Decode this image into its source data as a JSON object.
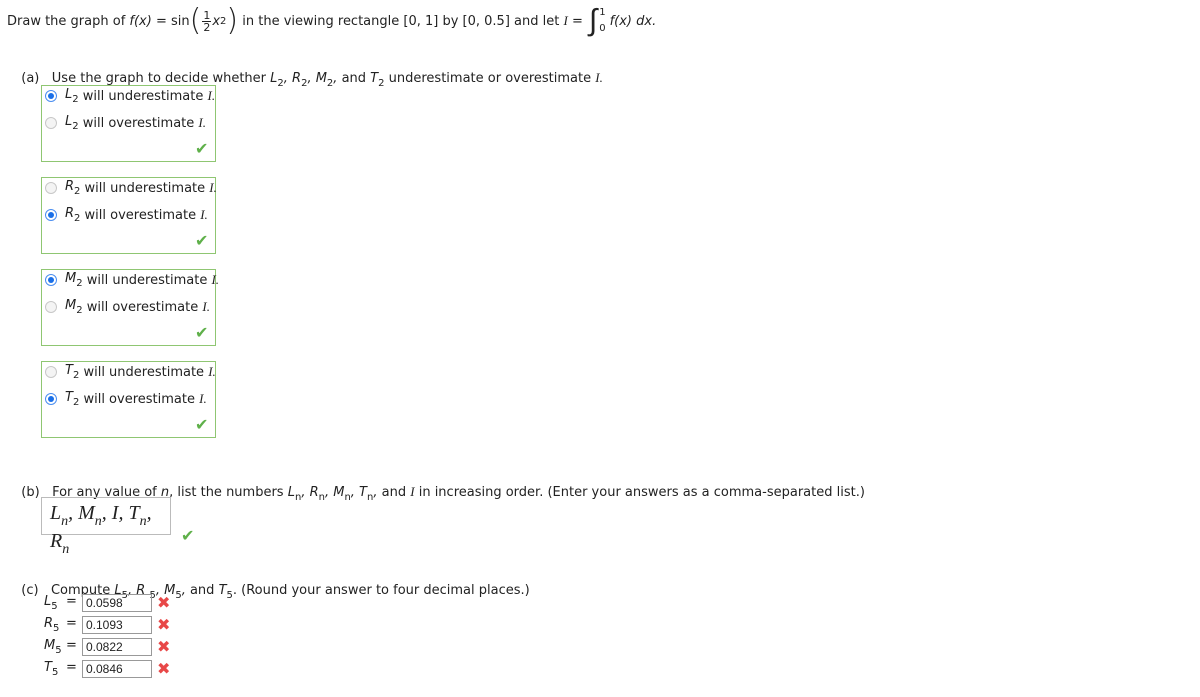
{
  "header": {
    "prefix": "Draw the graph of ",
    "fx": "f(x)",
    "eq_sin": " = sin",
    "frac_num": "1",
    "frac_den": "2",
    "x2": "x",
    "sup2": "2",
    "middle": " in the viewing rectangle [0, 1] by [0, 0.5] and let ",
    "I": "I",
    "eq": " = ",
    "int_upper": "1",
    "int_lower": "0",
    "integrand": "f(x) dx."
  },
  "part_a": {
    "label": "(a)",
    "text_prefix": "Use the graph to decide whether ",
    "text_suffix": " underestimate or overestimate ",
    "I": "I.",
    "groups": [
      {
        "sym": "L",
        "sub": "2",
        "options": [
          {
            "text": " will underestimate ",
            "selected": true
          },
          {
            "text": " will overestimate ",
            "selected": false
          }
        ]
      },
      {
        "sym": "R",
        "sub": "2",
        "options": [
          {
            "text": " will underestimate ",
            "selected": false
          },
          {
            "text": " will overestimate ",
            "selected": true
          }
        ]
      },
      {
        "sym": "M",
        "sub": "2",
        "options": [
          {
            "text": " will underestimate ",
            "selected": true
          },
          {
            "text": " will overestimate ",
            "selected": false
          }
        ]
      },
      {
        "sym": "T",
        "sub": "2",
        "options": [
          {
            "text": " will underestimate ",
            "selected": false
          },
          {
            "text": " will overestimate ",
            "selected": true
          }
        ]
      }
    ],
    "I_text": "I."
  },
  "part_b": {
    "label": "(b)",
    "text_prefix": "For any value of ",
    "n": "n",
    "text_mid": ", list the numbers ",
    "text_suffix": " and ",
    "I": "I",
    "text_end": " in increasing order. (Enter your answers as a comma-separated list.)",
    "answer": "L_n, M_n, I, T_n, R_n"
  },
  "part_c": {
    "label": "(c)",
    "text": "Compute ",
    "text_end": ". (Round your answer to four decimal places.)",
    "rows": [
      {
        "sym": "L",
        "sub": "5",
        "value": "0.0598",
        "correct": false
      },
      {
        "sym": "R",
        "sub": "5",
        "value": "0.1093",
        "correct": false
      },
      {
        "sym": "M",
        "sub": "5",
        "value": "0.0822",
        "correct": false
      },
      {
        "sym": "T",
        "sub": "5",
        "value": "0.0846",
        "correct": false
      }
    ]
  },
  "icons": {
    "check": "✔",
    "cross": "✖"
  }
}
